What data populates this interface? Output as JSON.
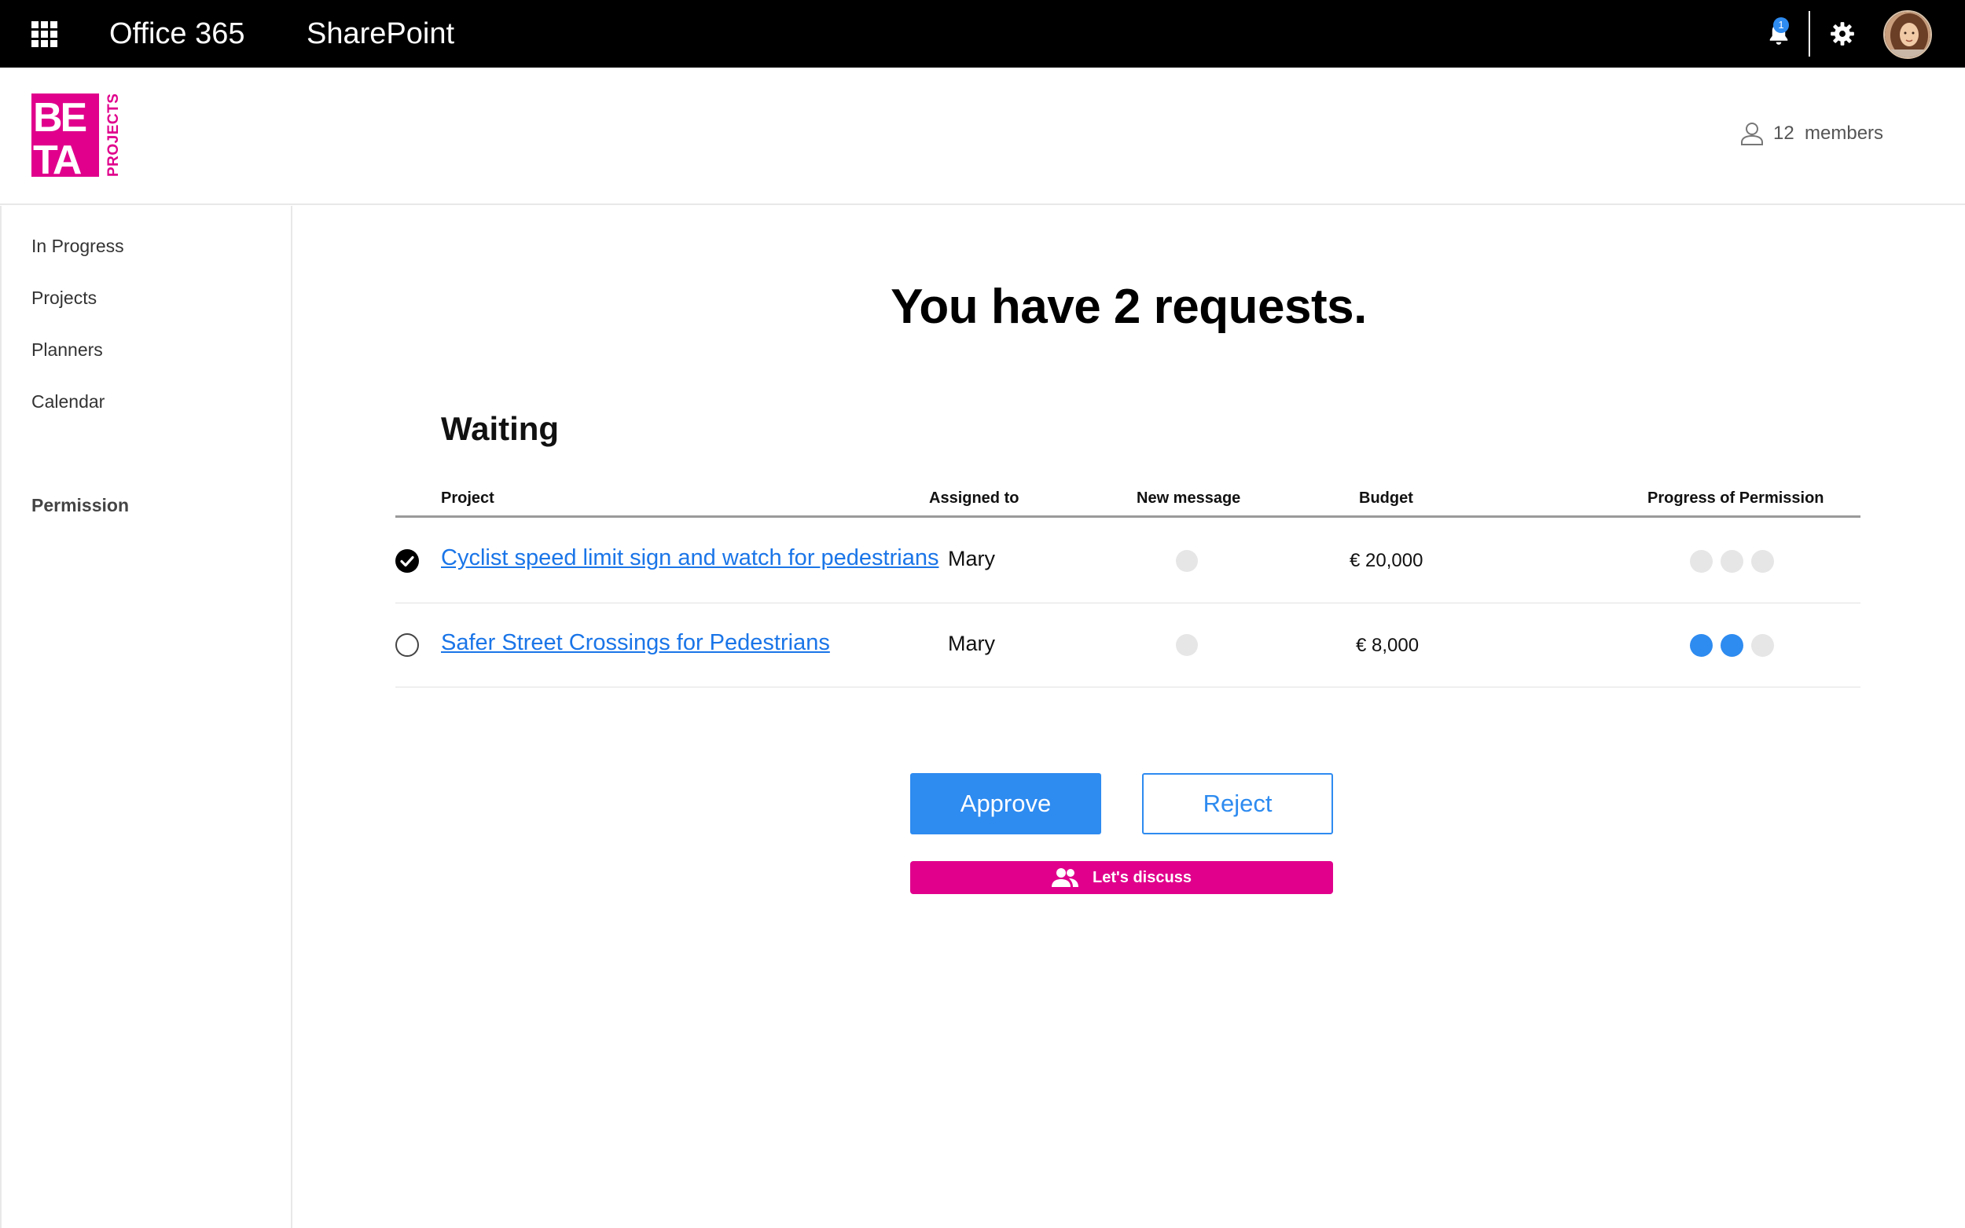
{
  "topbar": {
    "suite": "Office 365",
    "app": "SharePoint",
    "notification_count": "1",
    "icons": [
      "app-launcher-icon",
      "bell-icon",
      "gear-icon",
      "avatar"
    ]
  },
  "header": {
    "logo_letters": [
      "BE",
      "TA"
    ],
    "logo_subtext": "PROJECTS",
    "members_label": "12  members",
    "brand_color": "#e0008c"
  },
  "sidebar": {
    "items": [
      {
        "label": "In Progress"
      },
      {
        "label": "Projects"
      },
      {
        "label": "Planners"
      },
      {
        "label": "Calendar"
      }
    ],
    "permission_label": "Permission"
  },
  "main": {
    "title": "You have 2 requests.",
    "section": "Waiting",
    "columns": [
      "Project",
      "Assigned to",
      "New message",
      "Budget",
      "Progress of Permission"
    ],
    "rows": [
      {
        "selected": true,
        "project": "Cyclist speed limit sign and watch for pedestrians",
        "assigned_to": "Mary",
        "budget": "€ 20,000",
        "progress_of_3": 0
      },
      {
        "selected": false,
        "project": "Safer Street Crossings for Pedestrians",
        "assigned_to": "Mary",
        "budget": "€ 8,000",
        "progress_of_3": 2
      }
    ]
  },
  "actions": {
    "approve": "Approve",
    "reject": "Reject",
    "discuss": "Let's discuss"
  },
  "colors": {
    "accent": "#2e8bf0",
    "discuss": "#e0008c"
  }
}
